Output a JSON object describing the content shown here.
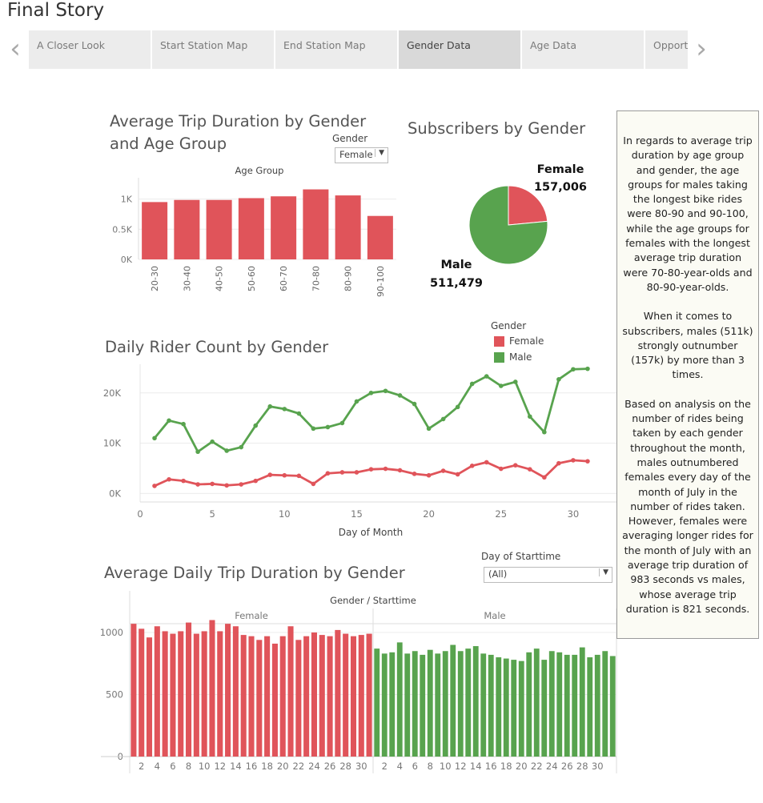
{
  "page": {
    "title": "Final Story",
    "nav_prev": "‹",
    "nav_next": "›",
    "tabs": [
      {
        "label": "A Closer Look",
        "active": false
      },
      {
        "label": "Start Station Map",
        "active": false
      },
      {
        "label": "End Station Map",
        "active": false
      },
      {
        "label": "Gender Data",
        "active": true
      },
      {
        "label": "Age Data",
        "active": false
      },
      {
        "label": "Opportu",
        "active": false
      }
    ]
  },
  "colors": {
    "female": "#e0545a",
    "male": "#58a34e"
  },
  "filters": {
    "gender_label": "Gender",
    "gender_value": "Female",
    "day_label": "Day of Starttime",
    "day_value": "(All)"
  },
  "story_text": [
    "In regards to average trip duration by age group and gender, the age groups for males taking the longest bike rides were 80-90 and 90-100, while the age groups for females with the longest average trip duration were 70-80-year-olds and 80-90-year-olds.",
    "When it comes to subscribers, males (511k) strongly outnumber (157k) by more than 3 times.",
    "Based on analysis on the number of rides being taken by each gender throughout the month, males outnumbered females every day of the month of July in the number of rides taken. However, females were averaging longer rides for the month of July with an average trip duration of 983 seconds vs males, whose average trip duration is 821 seconds."
  ],
  "chart_data": [
    {
      "type": "bar",
      "title": "Average Trip Duration by Gender and Age Group",
      "header": "Age Group",
      "categories": [
        "20-30",
        "30-40",
        "40-50",
        "50-60",
        "60-70",
        "70-80",
        "80-90",
        "90-100"
      ],
      "values": [
        950,
        985,
        985,
        1015,
        1045,
        1160,
        1060,
        720
      ],
      "yticks": [
        {
          "v": 0,
          "label": "0K"
        },
        {
          "v": 500,
          "label": "0.5K"
        },
        {
          "v": 1000,
          "label": "1K"
        }
      ],
      "ylim": [
        0,
        1300
      ]
    },
    {
      "type": "pie",
      "title": "Subscribers by Gender",
      "slices": [
        {
          "name": "Female",
          "value": 157006,
          "label": "157,006"
        },
        {
          "name": "Male",
          "value": 511479,
          "label": "511,479"
        }
      ]
    },
    {
      "type": "line",
      "title": "Daily Rider Count by Gender",
      "xlabel": "Day of Month",
      "legend_title": "Gender",
      "x": [
        1,
        2,
        3,
        4,
        5,
        6,
        7,
        8,
        9,
        10,
        11,
        12,
        13,
        14,
        15,
        16,
        17,
        18,
        19,
        20,
        21,
        22,
        23,
        24,
        25,
        26,
        27,
        28,
        29,
        30,
        31
      ],
      "xticks": [
        0,
        5,
        10,
        15,
        20,
        25,
        30
      ],
      "yticks": [
        {
          "v": 0,
          "label": "0K"
        },
        {
          "v": 10000,
          "label": "10K"
        },
        {
          "v": 20000,
          "label": "20K"
        }
      ],
      "xlim": [
        0,
        33
      ],
      "ylim": [
        -1700,
        25700
      ],
      "series": [
        {
          "name": "Female",
          "values": [
            1500,
            2800,
            2500,
            1800,
            1900,
            1600,
            1800,
            2500,
            3700,
            3600,
            3500,
            1900,
            4000,
            4200,
            4200,
            4800,
            4900,
            4600,
            3900,
            3600,
            4500,
            3800,
            5500,
            6200,
            4900,
            5600,
            4800,
            3200,
            6000,
            6600,
            6400
          ]
        },
        {
          "name": "Male",
          "values": [
            11000,
            14500,
            13800,
            8300,
            10300,
            8500,
            9200,
            13500,
            17300,
            16800,
            15900,
            12900,
            13200,
            14000,
            18300,
            20000,
            20400,
            19500,
            17800,
            12900,
            14800,
            17200,
            21800,
            23300,
            21400,
            22200,
            15300,
            12200,
            22700,
            24700,
            24800
          ]
        }
      ]
    },
    {
      "type": "bar",
      "title": "Average Daily Trip Duration by Gender",
      "header": "Gender / Starttime",
      "ylim": [
        0,
        1200
      ],
      "yticks": [
        0,
        500,
        1000
      ],
      "xticks": [
        2,
        4,
        6,
        8,
        10,
        12,
        14,
        16,
        18,
        20,
        22,
        24,
        26,
        28,
        30
      ],
      "series": [
        {
          "name": "Female",
          "values": [
            1070,
            1030,
            960,
            1050,
            1010,
            990,
            1010,
            1080,
            990,
            1010,
            1100,
            1010,
            1070,
            1050,
            980,
            970,
            940,
            970,
            910,
            970,
            1050,
            940,
            970,
            1000,
            980,
            970,
            1020,
            990,
            970,
            980,
            990
          ]
        },
        {
          "name": "Male",
          "values": [
            870,
            830,
            840,
            920,
            830,
            850,
            820,
            860,
            830,
            850,
            900,
            850,
            870,
            890,
            830,
            820,
            800,
            790,
            780,
            770,
            840,
            870,
            780,
            850,
            840,
            820,
            820,
            880,
            800,
            820,
            850,
            810
          ]
        }
      ]
    }
  ]
}
